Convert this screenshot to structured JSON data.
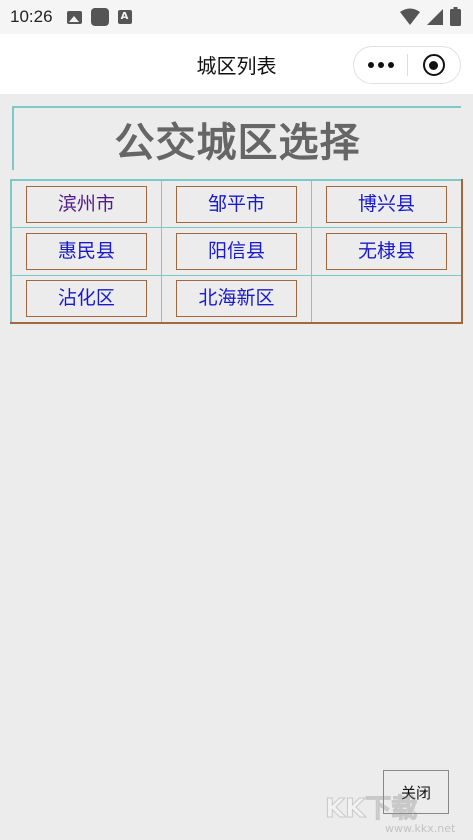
{
  "status_bar": {
    "time": "10:26",
    "icons": [
      "image-icon",
      "app-square-icon",
      "a-notification-icon"
    ],
    "right_icons": [
      "wifi-icon",
      "cellular-signal-icon",
      "battery-icon"
    ]
  },
  "title_bar": {
    "title": "城区列表",
    "capsule_icons": [
      "more-dots-icon",
      "target-close-icon"
    ]
  },
  "heading": "公交城区选择",
  "cities": [
    [
      "滨州市",
      "邹平市",
      "博兴县"
    ],
    [
      "惠民县",
      "阳信县",
      "无棣县"
    ],
    [
      "沾化区",
      "北海新区",
      ""
    ]
  ],
  "close_button": "关闭",
  "watermark": {
    "logo": "KK下载",
    "url": "www.kkx.net"
  },
  "colors": {
    "link": "#1a1acc",
    "visited_link": "#551a8b",
    "teal_border": "#7ec8c8",
    "brown_border": "#a0683c",
    "heading": "#666666",
    "background": "#ececec"
  }
}
